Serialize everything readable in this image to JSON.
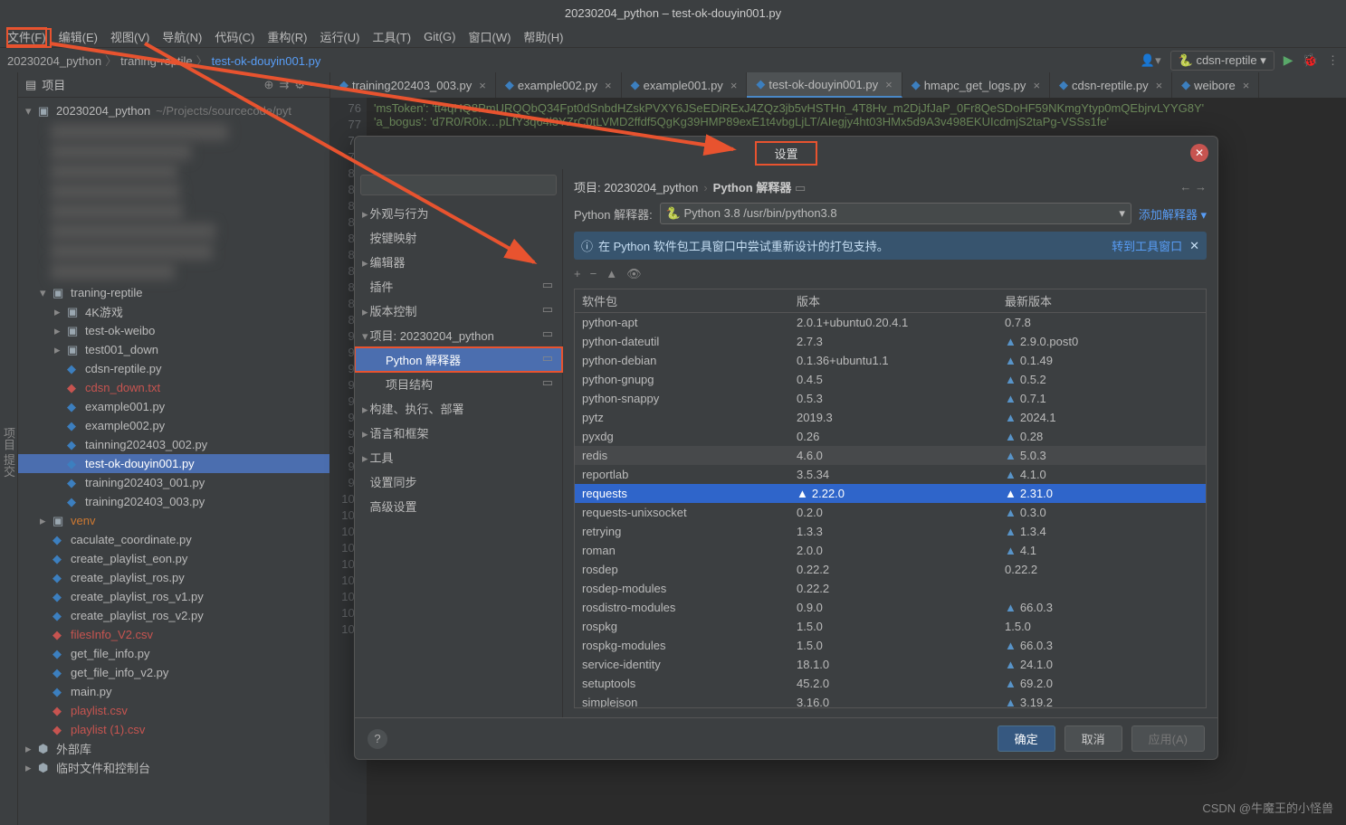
{
  "window_title": "20230204_python – test-ok-douyin001.py",
  "menu": [
    "文件(F)",
    "编辑(E)",
    "视图(V)",
    "导航(N)",
    "代码(C)",
    "重构(R)",
    "运行(U)",
    "工具(T)",
    "Git(G)",
    "窗口(W)",
    "帮助(H)"
  ],
  "breadcrumbs": [
    "20230204_python",
    "traning-reptile",
    "test-ok-douyin001.py"
  ],
  "run_config": "cdsn-reptile",
  "project_panel_title": "项目",
  "project_root": {
    "name": "20230204_python",
    "path": "~/Projects/sourcecode/pyt"
  },
  "tree": [
    {
      "name": "traning-reptile",
      "type": "folder",
      "expanded": true,
      "children": [
        {
          "name": "4K游戏",
          "type": "folder"
        },
        {
          "name": "test-ok-weibo",
          "type": "folder"
        },
        {
          "name": "test001_down",
          "type": "folder"
        },
        {
          "name": "cdsn-reptile.py",
          "type": "py"
        },
        {
          "name": "cdsn_down.txt",
          "type": "txt"
        },
        {
          "name": "example001.py",
          "type": "py"
        },
        {
          "name": "example002.py",
          "type": "py"
        },
        {
          "name": "tainning202403_002.py",
          "type": "py"
        },
        {
          "name": "test-ok-douyin001.py",
          "type": "py",
          "selected": true
        },
        {
          "name": "training202403_001.py",
          "type": "py"
        },
        {
          "name": "training202403_003.py",
          "type": "py"
        }
      ]
    },
    {
      "name": "venv",
      "type": "folder",
      "highlight": "orange"
    },
    {
      "name": "caculate_coordinate.py",
      "type": "py"
    },
    {
      "name": "create_playlist_eon.py",
      "type": "py"
    },
    {
      "name": "create_playlist_ros.py",
      "type": "py"
    },
    {
      "name": "create_playlist_ros_v1.py",
      "type": "py"
    },
    {
      "name": "create_playlist_ros_v2.py",
      "type": "py"
    },
    {
      "name": "filesInfo_V2.csv",
      "type": "csv"
    },
    {
      "name": "get_file_info.py",
      "type": "py"
    },
    {
      "name": "get_file_info_v2.py",
      "type": "py"
    },
    {
      "name": "main.py",
      "type": "py"
    },
    {
      "name": "playlist.csv",
      "type": "csv"
    },
    {
      "name": "playlist (1).csv",
      "type": "csv"
    }
  ],
  "tree_footer": [
    "外部库",
    "临时文件和控制台"
  ],
  "tabs": [
    {
      "label": "training202403_003.py"
    },
    {
      "label": "example002.py"
    },
    {
      "label": "example001.py"
    },
    {
      "label": "test-ok-douyin001.py",
      "active": true
    },
    {
      "label": "hmapc_get_logs.py"
    },
    {
      "label": "cdsn-reptile.py"
    },
    {
      "label": "weibore"
    }
  ],
  "code_lines": {
    "76": "'msToken': 'tt4qHQ8PmURQQbQ34Fpt0dSnbdHZskPVXY6JSeEDiRExJ4ZQz3jb5vHSTHn_4T8Hv_m2DjJfJaP_0Fr8QeSDoHF59NKmgYtyp0mQEbjrvLYYG8Y'",
    "77": "'a_bogus': 'd7R0/R0ix…pLfY3q64l3YZrC0tLVMD2ffdf5QgKg39HMP89exE1t4vbgLjLT/AIegjy4ht03HMx5d9A3v498EKUIcdmjS2taPg-VSSs1fe'"
  },
  "dialog": {
    "title": "设置",
    "search_placeholder": "",
    "categories": [
      {
        "label": "外观与行为",
        "children": null,
        "top": true
      },
      {
        "label": "按键映射",
        "children": null,
        "top": true
      },
      {
        "label": "编辑器",
        "children": null,
        "top": true
      },
      {
        "label": "插件",
        "children": null,
        "top": true,
        "gear": true
      },
      {
        "label": "版本控制",
        "children": null,
        "top": true,
        "gear": true
      },
      {
        "label": "项目: 20230204_python",
        "children": [
          {
            "label": "Python 解释器",
            "selected": true,
            "gear": true
          },
          {
            "label": "项目结构",
            "gear": true
          }
        ],
        "top": true,
        "expanded": true,
        "gear": true
      },
      {
        "label": "构建、执行、部署",
        "children": null,
        "top": true
      },
      {
        "label": "语言和框架",
        "children": null,
        "top": true
      },
      {
        "label": "工具",
        "children": null,
        "top": true
      },
      {
        "label": "设置同步",
        "children": null,
        "top": true
      },
      {
        "label": "高级设置",
        "children": null,
        "top": true
      }
    ],
    "crumb_project": "项目: 20230204_python",
    "crumb_page": "Python 解释器",
    "interp_label": "Python 解释器:",
    "interp_value": "Python 3.8 /usr/bin/python3.8",
    "add_interp": "添加解释器",
    "banner_text": "在 Python 软件包工具窗口中尝试重新设计的打包支持。",
    "banner_link": "转到工具窗口",
    "columns": [
      "软件包",
      "版本",
      "最新版本"
    ],
    "packages": [
      {
        "n": "python-apt",
        "v": "2.0.1+ubuntu0.20.4.1",
        "l": "0.7.8"
      },
      {
        "n": "python-dateutil",
        "v": "2.7.3",
        "l": "2.9.0.post0",
        "up": true
      },
      {
        "n": "python-debian",
        "v": "0.1.36+ubuntu1.1",
        "l": "0.1.49",
        "up": true
      },
      {
        "n": "python-gnupg",
        "v": "0.4.5",
        "l": "0.5.2",
        "up": true
      },
      {
        "n": "python-snappy",
        "v": "0.5.3",
        "l": "0.7.1",
        "up": true
      },
      {
        "n": "pytz",
        "v": "2019.3",
        "l": "2024.1",
        "up": true
      },
      {
        "n": "pyxdg",
        "v": "0.26",
        "l": "0.28",
        "up": true
      },
      {
        "n": "redis",
        "v": "4.6.0",
        "l": "5.0.3",
        "up": true,
        "hl": true
      },
      {
        "n": "reportlab",
        "v": "3.5.34",
        "l": "4.1.0",
        "up": true
      },
      {
        "n": "requests",
        "v": "2.22.0",
        "l": "2.31.0",
        "up": true,
        "sel": true
      },
      {
        "n": "requests-unixsocket",
        "v": "0.2.0",
        "l": "0.3.0",
        "up": true
      },
      {
        "n": "retrying",
        "v": "1.3.3",
        "l": "1.3.4",
        "up": true
      },
      {
        "n": "roman",
        "v": "2.0.0",
        "l": "4.1",
        "up": true
      },
      {
        "n": "rosdep",
        "v": "0.22.2",
        "l": "0.22.2"
      },
      {
        "n": "rosdep-modules",
        "v": "0.22.2",
        "l": ""
      },
      {
        "n": "rosdistro-modules",
        "v": "0.9.0",
        "l": "66.0.3",
        "up": true
      },
      {
        "n": "rospkg",
        "v": "1.5.0",
        "l": "1.5.0"
      },
      {
        "n": "rospkg-modules",
        "v": "1.5.0",
        "l": "66.0.3",
        "up": true
      },
      {
        "n": "service-identity",
        "v": "18.1.0",
        "l": "24.1.0",
        "up": true
      },
      {
        "n": "setuptools",
        "v": "45.2.0",
        "l": "69.2.0",
        "up": true
      },
      {
        "n": "simplejson",
        "v": "3.16.0",
        "l": "3.19.2",
        "up": true
      }
    ],
    "ok": "确定",
    "cancel": "取消",
    "apply": "应用(A)"
  },
  "watermark": "CSDN @牛魔王的小怪兽",
  "left_gutter": "项目  提交"
}
